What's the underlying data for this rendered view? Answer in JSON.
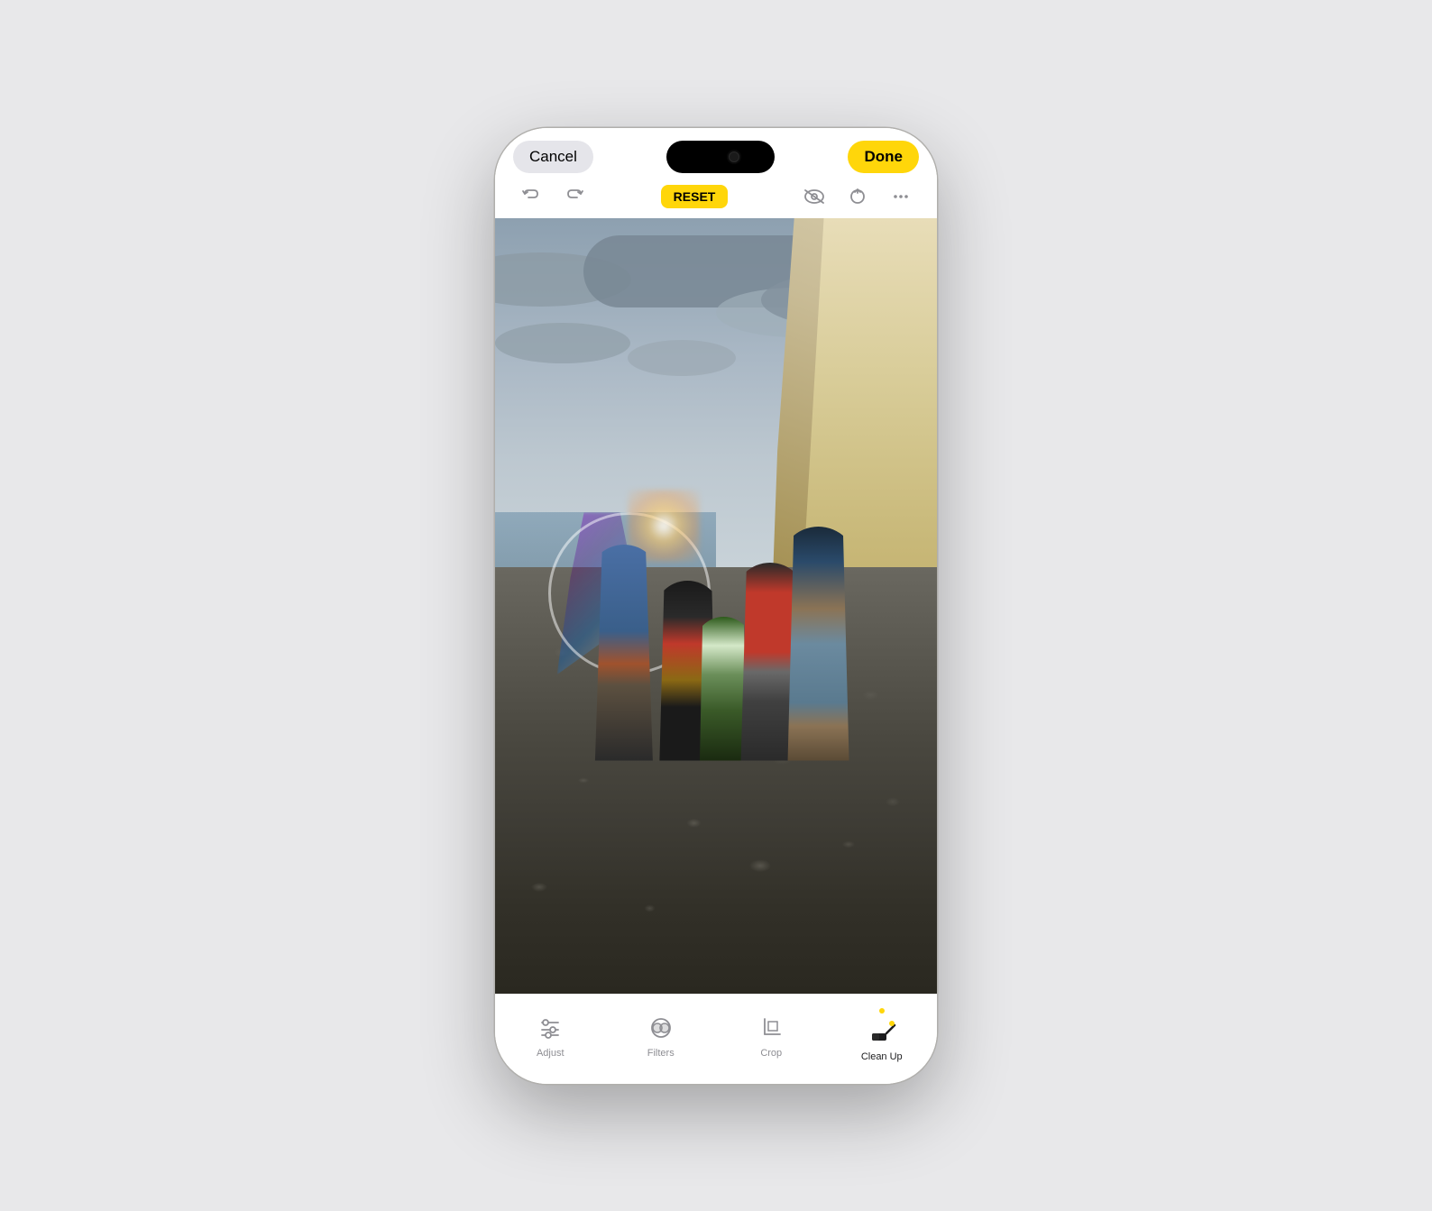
{
  "header": {
    "cancel_label": "Cancel",
    "done_label": "Done",
    "reset_label": "RESET"
  },
  "toolbar": {
    "items": [
      {
        "id": "adjust",
        "label": "Adjust",
        "active": false
      },
      {
        "id": "filters",
        "label": "Filters",
        "active": false
      },
      {
        "id": "crop",
        "label": "Crop",
        "active": false
      },
      {
        "id": "cleanup",
        "label": "Clean Up",
        "active": true
      }
    ]
  },
  "colors": {
    "accent": "#ffd60a",
    "active_tool": "#1c1c1e",
    "inactive_tool": "#8e8e93"
  },
  "icons": {
    "undo": "↩",
    "redo": "↪",
    "eye_slash": "👁",
    "arrow_up": "↑",
    "ellipsis": "···"
  }
}
